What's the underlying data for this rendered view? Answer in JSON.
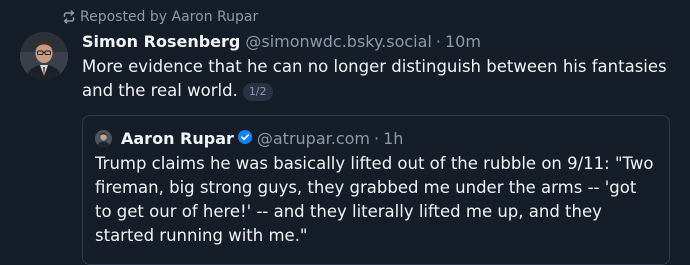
{
  "repost": {
    "text": "Reposted by Aaron Rupar"
  },
  "post": {
    "author_name": "Simon Rosenberg",
    "handle": "@simonwdc.bsky.social",
    "separator": "·",
    "time": "10m",
    "text": "More evidence that he can no longer distinguish between his fantasies and the real world.",
    "thread_badge": "1/2"
  },
  "quote": {
    "author_name": "Aaron Rupar",
    "handle": "@atrupar.com",
    "separator": "·",
    "time": "1h",
    "text": "Trump claims he was basically lifted out of the rubble on 9/11: \"Two fireman, big strong guys, they grabbed me under the arms -- 'got to get our of here!' -- and they literally lifted me up, and they started running with me.\""
  },
  "icons": {
    "repost": "repost-icon",
    "verified": "verified-check-icon"
  },
  "colors": {
    "background": "#151d28",
    "text": "#f1f3f5",
    "muted": "#8d9aab",
    "card_border": "#2e3a49",
    "verified": "#1083fe"
  }
}
